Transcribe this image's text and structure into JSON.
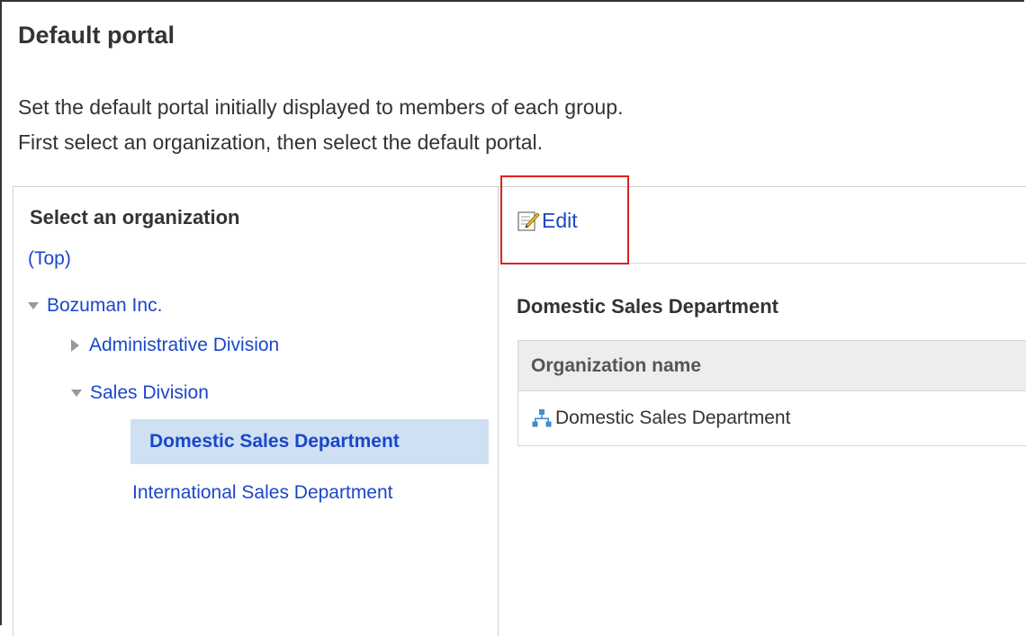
{
  "page": {
    "title": "Default portal",
    "description_line1": "Set the default portal initially displayed to members of each group.",
    "description_line2": "First select an organization, then select the default portal."
  },
  "org_panel": {
    "heading": "Select an organization",
    "top_link": "(Top)",
    "tree": [
      {
        "label": "Bozuman Inc.",
        "state": "expanded"
      },
      {
        "label": "Administrative Division",
        "state": "collapsed"
      },
      {
        "label": "Sales Division",
        "state": "expanded"
      },
      {
        "label": "Domestic Sales Department",
        "state": "selected"
      },
      {
        "label": "International Sales Department",
        "state": "leaf"
      }
    ]
  },
  "portal_panel": {
    "edit_label": "Edit",
    "edit_icon": "edit-pencil-icon",
    "department_title": "Domestic Sales Department",
    "table": {
      "header": "Organization name",
      "rows": [
        {
          "icon": "organization-icon",
          "name": "Domestic Sales Department"
        }
      ]
    }
  },
  "colors": {
    "link": "#1a47c9",
    "selected_background": "#cfe0f2",
    "highlight_border": "#e02020",
    "table_header_background": "#ededed",
    "org_icon": "#3d8fd1"
  }
}
